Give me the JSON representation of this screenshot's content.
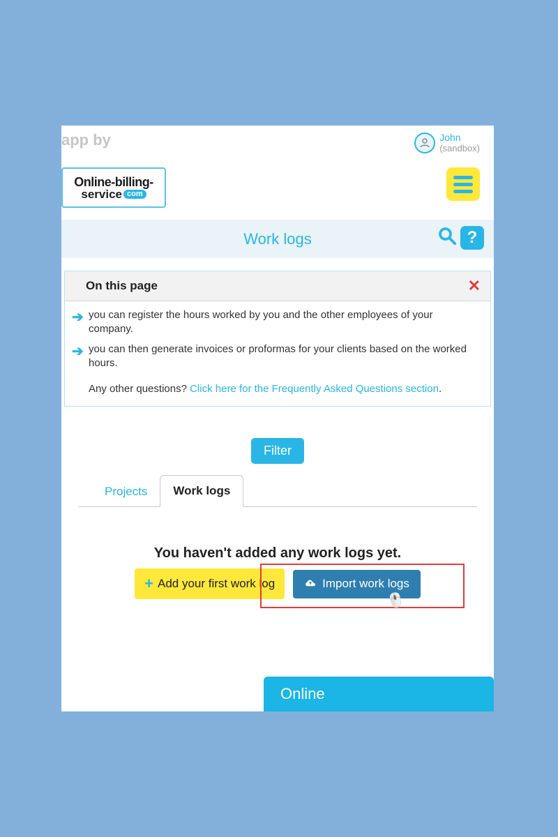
{
  "app_by": "app by",
  "logo": {
    "line1": "Online-billing-",
    "line2": "service",
    "badge": "com"
  },
  "user": {
    "name": "John",
    "context": "(sandbox)"
  },
  "page_title": "Work logs",
  "help_glyph": "?",
  "info": {
    "header": "On this page",
    "items": [
      "you can register the hours worked by you and the other employees of your company.",
      "you can then generate invoices or proformas for your clients based on the worked hours."
    ],
    "faq_prefix": "Any other questions? ",
    "faq_link": "Click here for the Frequently Asked Questions section",
    "faq_suffix": "."
  },
  "filter_label": "Filter",
  "tabs": {
    "projects": "Projects",
    "worklogs": "Work logs"
  },
  "empty": {
    "title": "You haven't added any work logs yet.",
    "add_label": "Add your first work log",
    "import_label": "Import work logs"
  },
  "chat_label": "Online"
}
